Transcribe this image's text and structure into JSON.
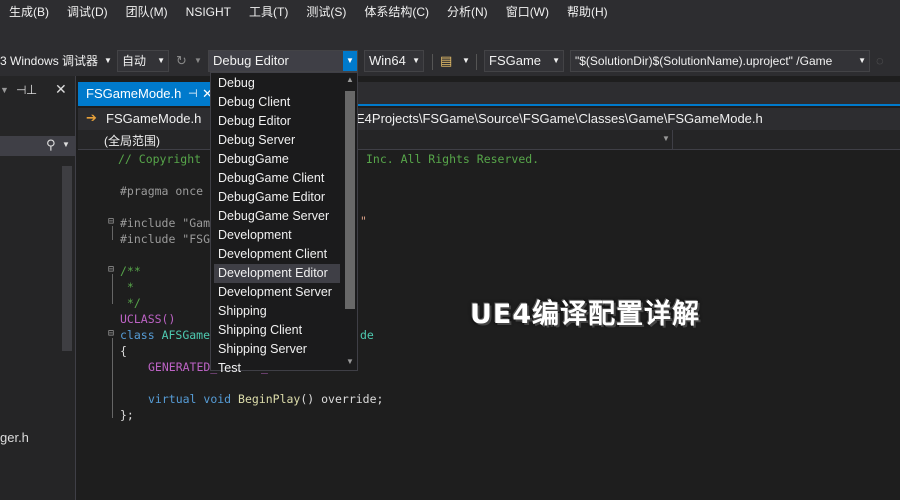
{
  "menubar": {
    "items": [
      "生成(B)",
      "调试(D)",
      "团队(M)",
      "NSIGHT",
      "工具(T)",
      "测试(S)",
      "体系结构(C)",
      "分析(N)",
      "窗口(W)",
      "帮助(H)"
    ]
  },
  "toolbar": {
    "debugger_label": "3 Windows 调试器",
    "auto_combo": "自动",
    "config_combo": "Debug Editor",
    "platform_combo": "Win64",
    "project_combo": "FSGame",
    "command_combo": "\"$(SolutionDir)$(SolutionName).uproject\" /Game"
  },
  "tabs": {
    "active_label": "FSGameMode.h"
  },
  "navbar": {
    "file_label": "FSGameMode.h",
    "path_label": "E4Projects\\FSGame\\Source\\FSGame\\Classes\\Game\\FSGameMode.h"
  },
  "scopebar": {
    "scope_label": "(全局范围)"
  },
  "left_panel": {
    "item_label": "ger.h"
  },
  "dropdown": {
    "selected_index": 10,
    "items": [
      "Debug",
      "Debug Client",
      "Debug Editor",
      "Debug Server",
      "DebugGame",
      "DebugGame Client",
      "DebugGame Editor",
      "DebugGame Server",
      "Development",
      "Development Client",
      "Development Editor",
      "Development Server",
      "Shipping",
      "Shipping Client",
      "Shipping Server",
      "Test"
    ]
  },
  "code": {
    "line1a": "// Copyright ",
    "line1b": "Inc. All Rights Reserved.",
    "pragma": "#pragma once",
    "include1": "#include \"Gam",
    "include1_tail": "\"",
    "include2": "#include \"FSG",
    "comment_open": "/**",
    "comment_star": " *",
    "comment_close": " */",
    "uclass": "UCLASS()",
    "class_kw": "class",
    "class_name": "AFSGame",
    "class_tail": "de",
    "brace_open": "{",
    "generated": "GENERATED_",
    "generated_tail": "_",
    "virtual_kw": "virtual",
    "void_kw": "void",
    "fn_name": "BeginPlay",
    "fn_tail": "() override;",
    "brace_close": "};"
  },
  "watermark": {
    "text": "UE4编译配置详解"
  },
  "colors": {
    "accent": "#007acc",
    "background": "#1e1e1e",
    "chrome": "#2d2d30"
  }
}
